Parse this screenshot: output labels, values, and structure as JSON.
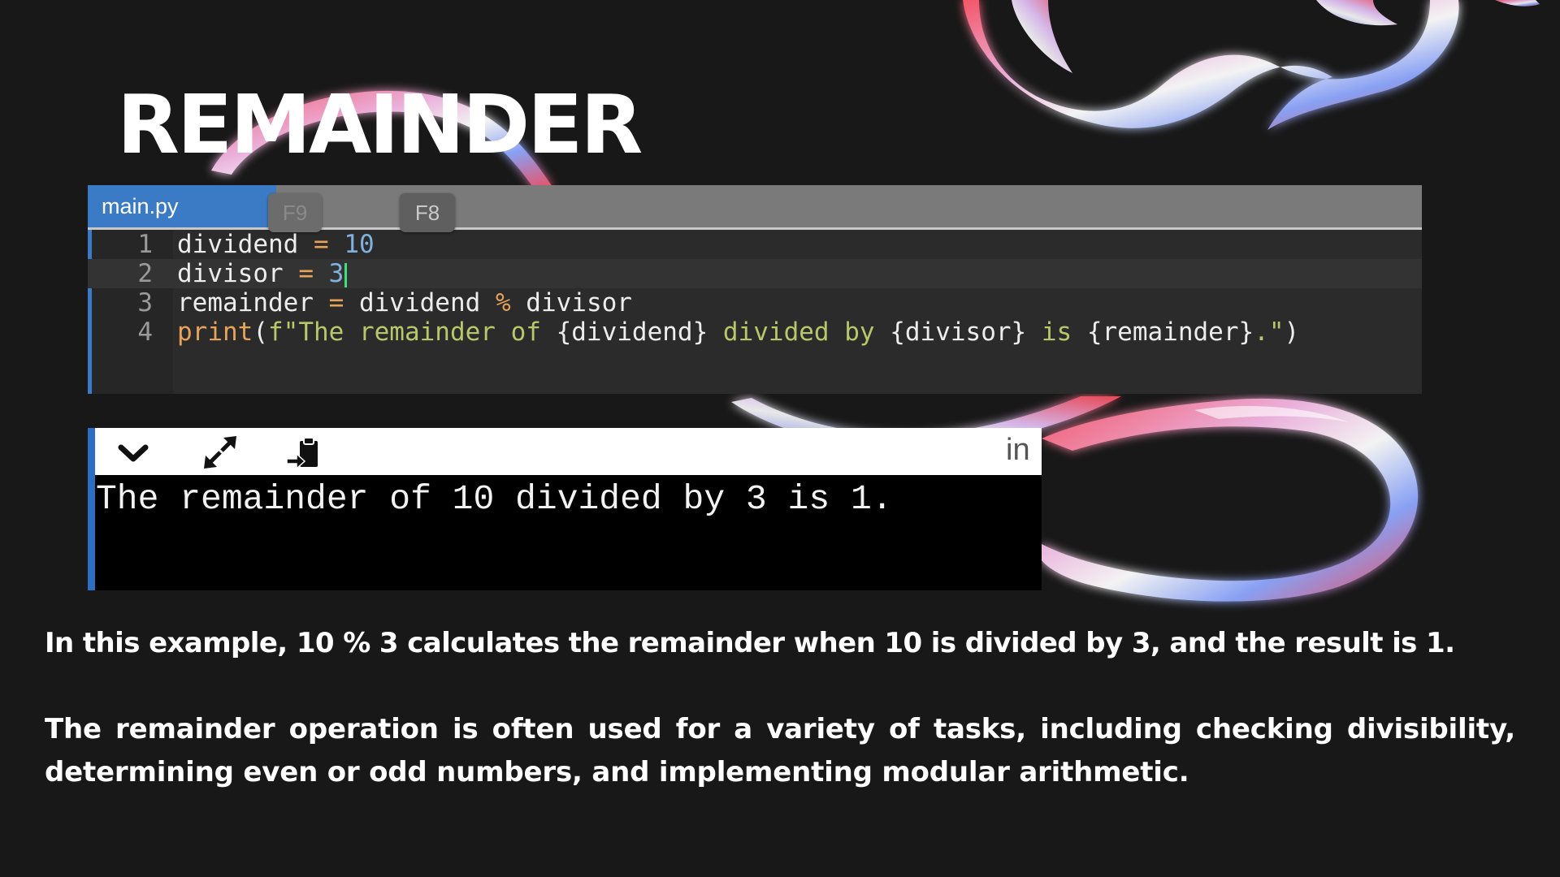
{
  "slide": {
    "title": "REMAINDER"
  },
  "editor": {
    "tab_label": "main.py",
    "key_hints": [
      "F9",
      "F8"
    ],
    "lines": [
      {
        "number": "1",
        "tokens": [
          {
            "text": "dividend",
            "kind": "var"
          },
          {
            "text": " = ",
            "kind": "op"
          },
          {
            "text": "10",
            "kind": "num"
          }
        ]
      },
      {
        "number": "2",
        "current": true,
        "tokens": [
          {
            "text": "divisor",
            "kind": "var"
          },
          {
            "text": " = ",
            "kind": "op"
          },
          {
            "text": "3",
            "kind": "num"
          }
        ]
      },
      {
        "number": "3",
        "tokens": [
          {
            "text": "remainder",
            "kind": "var"
          },
          {
            "text": " = ",
            "kind": "op"
          },
          {
            "text": "dividend",
            "kind": "var"
          },
          {
            "text": " % ",
            "kind": "op"
          },
          {
            "text": "divisor",
            "kind": "var"
          }
        ]
      },
      {
        "number": "4",
        "tokens": [
          {
            "text": "print",
            "kind": "fn"
          },
          {
            "text": "(",
            "kind": "var"
          },
          {
            "text": "f\"The remainder of ",
            "kind": "str"
          },
          {
            "text": "{dividend}",
            "kind": "var"
          },
          {
            "text": " divided by ",
            "kind": "str"
          },
          {
            "text": "{divisor}",
            "kind": "var"
          },
          {
            "text": " is ",
            "kind": "str"
          },
          {
            "text": "{remainder}",
            "kind": "var"
          },
          {
            "text": ".\"",
            "kind": "str"
          },
          {
            "text": ")",
            "kind": "var"
          }
        ]
      }
    ]
  },
  "console": {
    "toolbar_icons": [
      "chevron-down-icon",
      "expand-arrows-icon",
      "clipboard-icon"
    ],
    "partial_label": "in",
    "output": "The remainder of 10 divided by 3 is 1."
  },
  "text": {
    "paragraph_1": "In this example, 10 % 3 calculates the remainder when 10 is divided by 3, and the result is 1.",
    "paragraph_2": "The remainder operation is often used for a variety of tasks, including checking divisibility, determining even or odd numbers, and implementing modular arithmetic."
  },
  "colors": {
    "background": "#181818",
    "editor_bg": "#2b2b2b",
    "tab_active": "#3b7ac4",
    "operator": "#e8a35a",
    "number": "#7fb2de",
    "string": "#b7c76a",
    "cursor": "#3fe07a"
  }
}
